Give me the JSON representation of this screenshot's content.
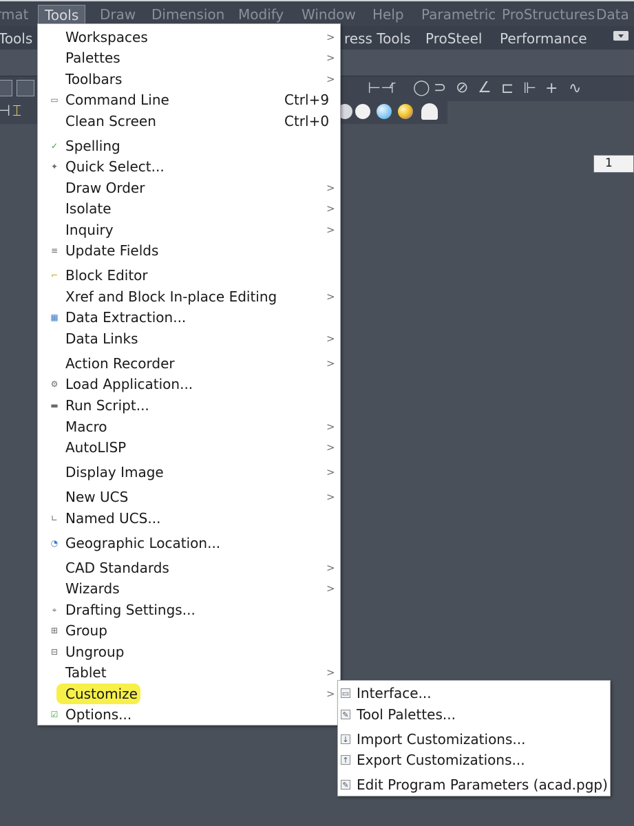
{
  "menubar": {
    "items": [
      "rmat",
      "Tools",
      "Draw",
      "Dimension",
      "Modify",
      "Window",
      "Help",
      "Parametric",
      "ProStructures",
      "Data V"
    ],
    "active": "Tools"
  },
  "ribbon_tabs": [
    "Tools",
    "ress Tools",
    "ProSteel",
    "Performance"
  ],
  "toolbar": {
    "scale_value": "1"
  },
  "tools_menu": {
    "items": [
      {
        "label": "Workspaces",
        "submenu": true,
        "icon": ""
      },
      {
        "label": "Palettes",
        "submenu": true,
        "icon": ""
      },
      {
        "label": "Toolbars",
        "submenu": true,
        "icon": ""
      },
      {
        "label": "Command Line",
        "shortcut": "Ctrl+9",
        "icon": "command-line-icon"
      },
      {
        "label": "Clean Screen",
        "shortcut": "Ctrl+0",
        "icon": ""
      },
      {
        "label": "Spelling",
        "icon": "spelling-icon"
      },
      {
        "label": "Quick Select...",
        "icon": "quick-select-icon"
      },
      {
        "label": "Draw Order",
        "submenu": true,
        "icon": ""
      },
      {
        "label": "Isolate",
        "submenu": true,
        "icon": ""
      },
      {
        "label": "Inquiry",
        "submenu": true,
        "icon": ""
      },
      {
        "label": "Update Fields",
        "icon": "update-fields-icon"
      },
      {
        "label": "Block Editor",
        "icon": "block-editor-icon"
      },
      {
        "label": "Xref and Block In-place Editing",
        "submenu": true,
        "icon": ""
      },
      {
        "label": "Data Extraction...",
        "icon": "data-extraction-icon"
      },
      {
        "label": "Data Links",
        "submenu": true,
        "icon": ""
      },
      {
        "label": "Action Recorder",
        "submenu": true,
        "icon": ""
      },
      {
        "label": "Load Application...",
        "icon": "load-application-icon"
      },
      {
        "label": "Run Script...",
        "icon": "run-script-icon"
      },
      {
        "label": "Macro",
        "submenu": true,
        "icon": ""
      },
      {
        "label": "AutoLISP",
        "submenu": true,
        "icon": ""
      },
      {
        "label": "Display Image",
        "submenu": true,
        "icon": ""
      },
      {
        "label": "New UCS",
        "submenu": true,
        "icon": ""
      },
      {
        "label": "Named UCS...",
        "icon": "named-ucs-icon"
      },
      {
        "label": "Geographic Location...",
        "icon": "geographic-location-icon"
      },
      {
        "label": "CAD Standards",
        "submenu": true,
        "icon": ""
      },
      {
        "label": "Wizards",
        "submenu": true,
        "icon": ""
      },
      {
        "label": "Drafting Settings...",
        "icon": "drafting-settings-icon"
      },
      {
        "label": "Group",
        "icon": "group-icon"
      },
      {
        "label": "Ungroup",
        "icon": "ungroup-icon"
      },
      {
        "label": "Tablet",
        "submenu": true,
        "icon": ""
      },
      {
        "label": "Customize",
        "submenu": true,
        "icon": "",
        "highlighted": true
      },
      {
        "label": "Options...",
        "icon": "options-icon"
      }
    ]
  },
  "customize_submenu": {
    "items": [
      {
        "label": "Interface...",
        "icon": "interface-icon"
      },
      {
        "label": "Tool Palettes...",
        "icon": "tool-palettes-icon"
      },
      {
        "label": "Import Customizations...",
        "icon": "import-customizations-icon"
      },
      {
        "label": "Export Customizations...",
        "icon": "export-customizations-icon",
        "highlighted": true
      },
      {
        "label": "Edit Program Parameters (acad.pgp)",
        "icon": "edit-program-parameters-icon"
      }
    ]
  },
  "colors": {
    "highlight": "#f6ef3a",
    "background": "#4a5059",
    "menu": "#ffffff"
  }
}
